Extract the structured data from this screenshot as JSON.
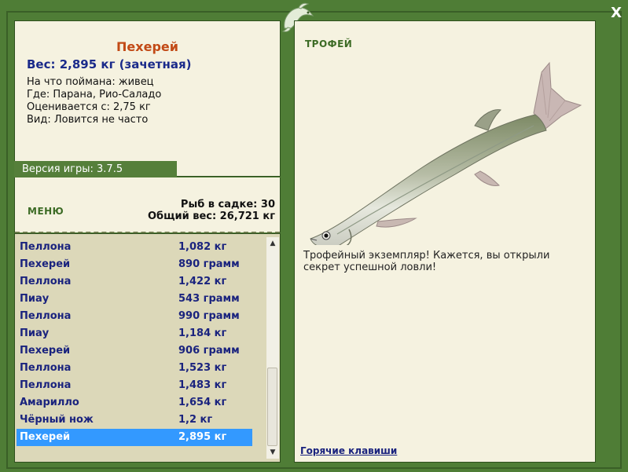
{
  "window": {
    "close_label": "X"
  },
  "info": {
    "fish_name": "Пехерей",
    "weight_line": "Вес: 2,895 кг (зачетная)",
    "bait": "На что поймана: живец",
    "location": "Где: Парана, Рио-Саладо",
    "valued_from": "Оценивается с: 2,75 кг",
    "species_note": "Вид: Ловится не часто"
  },
  "version_label": "Версия игры: 3.7.5",
  "menu_label": "меню",
  "stats": {
    "fish_count": "Рыб в садке: 30",
    "total_weight": "Общий вес: 26,721 кг"
  },
  "catch_list": [
    {
      "name": "Пеллона",
      "weight": "1,082 кг"
    },
    {
      "name": "Пехерей",
      "weight": "890 грамм"
    },
    {
      "name": "Пеллона",
      "weight": "1,422 кг"
    },
    {
      "name": "Пиау",
      "weight": "543 грамм"
    },
    {
      "name": "Пеллона",
      "weight": "990 грамм"
    },
    {
      "name": "Пиау",
      "weight": "1,184 кг"
    },
    {
      "name": "Пехерей",
      "weight": "906 грамм"
    },
    {
      "name": "Пеллона",
      "weight": "1,523 кг"
    },
    {
      "name": "Пеллона",
      "weight": "1,483 кг"
    },
    {
      "name": "Амарилло",
      "weight": "1,654 кг"
    },
    {
      "name": "Чёрный нож",
      "weight": "1,2 кг"
    },
    {
      "name": "Пехерей",
      "weight": "2,895 кг",
      "selected": true
    }
  ],
  "scrollbar": {
    "up_icon": "scroll-up-arrow",
    "down_icon": "scroll-down-arrow"
  },
  "trophy": {
    "title": "Трофей",
    "description": "Трофейный экземпляр! Кажется, вы открыли секрет успешной ловли!",
    "hotkeys_label": "Горячие клавиши"
  },
  "colors": {
    "frame": "#4f7d36",
    "panel": "#f5f2e0",
    "list_bg": "#dcd8b9",
    "selection": "#3399ff",
    "fish_name": "#c24a16",
    "text_blue": "#1a237e"
  }
}
